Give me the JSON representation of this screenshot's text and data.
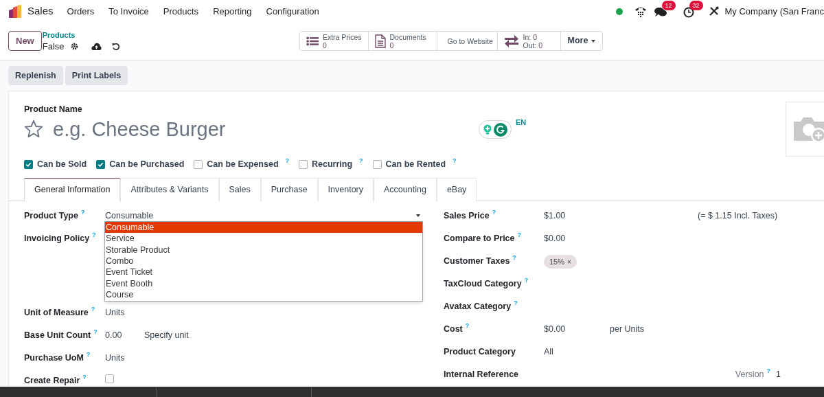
{
  "navbar": {
    "app_name": "Sales",
    "menu": [
      "Orders",
      "To Invoice",
      "Products",
      "Reporting",
      "Configuration"
    ],
    "chat_count": "12",
    "activity_count": "32",
    "company": "My Company (San Franc"
  },
  "control_panel": {
    "new_button": "New",
    "breadcrumb": "Products",
    "record": "False",
    "stat_buttons": [
      {
        "kind": "list",
        "label": "Extra Prices",
        "value": "0"
      },
      {
        "kind": "document",
        "label": "Documents",
        "value": "0"
      },
      {
        "kind": "website",
        "label": "Go to Website"
      },
      {
        "kind": "transfer",
        "lines": [
          {
            "label": "In:",
            "value": "0"
          },
          {
            "label": "Out:",
            "value": "0"
          }
        ]
      }
    ],
    "more_button": "More"
  },
  "actions": [
    "Replenish",
    "Print Labels"
  ],
  "form": {
    "name_label": "Product Name",
    "name_placeholder": "e.g. Cheese Burger",
    "starred": false,
    "language": "EN",
    "checkboxes": [
      {
        "label": "Can be Sold",
        "checked": true
      },
      {
        "label": "Can be Purchased",
        "checked": true
      },
      {
        "label": "Can be Expensed",
        "checked": false,
        "help": "?"
      },
      {
        "label": "Recurring",
        "checked": false,
        "help": "?"
      },
      {
        "label": "Can be Rented",
        "checked": false,
        "help": "?"
      }
    ],
    "tabs": [
      {
        "label": "General Information",
        "selected": true
      },
      {
        "label": "Attributes & Variants",
        "selected": false
      },
      {
        "label": "Sales",
        "selected": false
      },
      {
        "label": "Purchase",
        "selected": false
      },
      {
        "label": "Inventory",
        "selected": false
      },
      {
        "label": "Accounting",
        "selected": false
      },
      {
        "label": "eBay",
        "selected": false
      }
    ],
    "left_fields": [
      {
        "kind": "select",
        "label": "Product Type",
        "help": "?",
        "value": "Consumable"
      },
      {
        "kind": "radio",
        "label": "Invoicing Policy",
        "help": "?"
      },
      {
        "kind": "text",
        "label": "Unit of Measure",
        "help": "?",
        "value": "Units"
      },
      {
        "kind": "text",
        "label": "Base Unit Count",
        "help": "?",
        "value": "0.00",
        "unit": "Specify unit"
      },
      {
        "kind": "text",
        "label": "Purchase UoM",
        "help": "?",
        "value": "Units"
      },
      {
        "kind": "checkbox",
        "label": "Create Repair",
        "help": "?",
        "checked": false
      }
    ],
    "right_fields": [
      {
        "kind": "text",
        "label": "Sales Price",
        "help": "?",
        "value": "$1.00",
        "note": "(= $ 1.15 Incl. Taxes)"
      },
      {
        "kind": "text",
        "label": "Compare to Price",
        "help": "?",
        "value": "$0.00"
      },
      {
        "kind": "tags",
        "label": "Customer Taxes",
        "help": "?",
        "tags": [
          {
            "label": "15%",
            "remove": "×"
          }
        ]
      },
      {
        "kind": "text",
        "label": "TaxCloud Category",
        "help": "?"
      },
      {
        "kind": "text",
        "label": "Avatax Category",
        "help": "?"
      },
      {
        "kind": "text",
        "label": "Cost",
        "help": "?",
        "value": "$0.00",
        "unit": "per Units"
      },
      {
        "kind": "text",
        "label": "Product Category",
        "value": "All"
      },
      {
        "kind": "version",
        "label": "Internal Reference",
        "side_label": "Version",
        "side_help": "?",
        "side_value": "1"
      }
    ],
    "dropdown": [
      {
        "label": "Consumable",
        "selected": true
      },
      {
        "label": "Service",
        "selected": false
      },
      {
        "label": "Storable Product",
        "selected": false
      },
      {
        "label": "Combo",
        "selected": false
      },
      {
        "label": "Event Ticket",
        "selected": false
      },
      {
        "label": "Event Booth",
        "selected": false
      },
      {
        "label": "Course",
        "selected": false
      }
    ]
  }
}
